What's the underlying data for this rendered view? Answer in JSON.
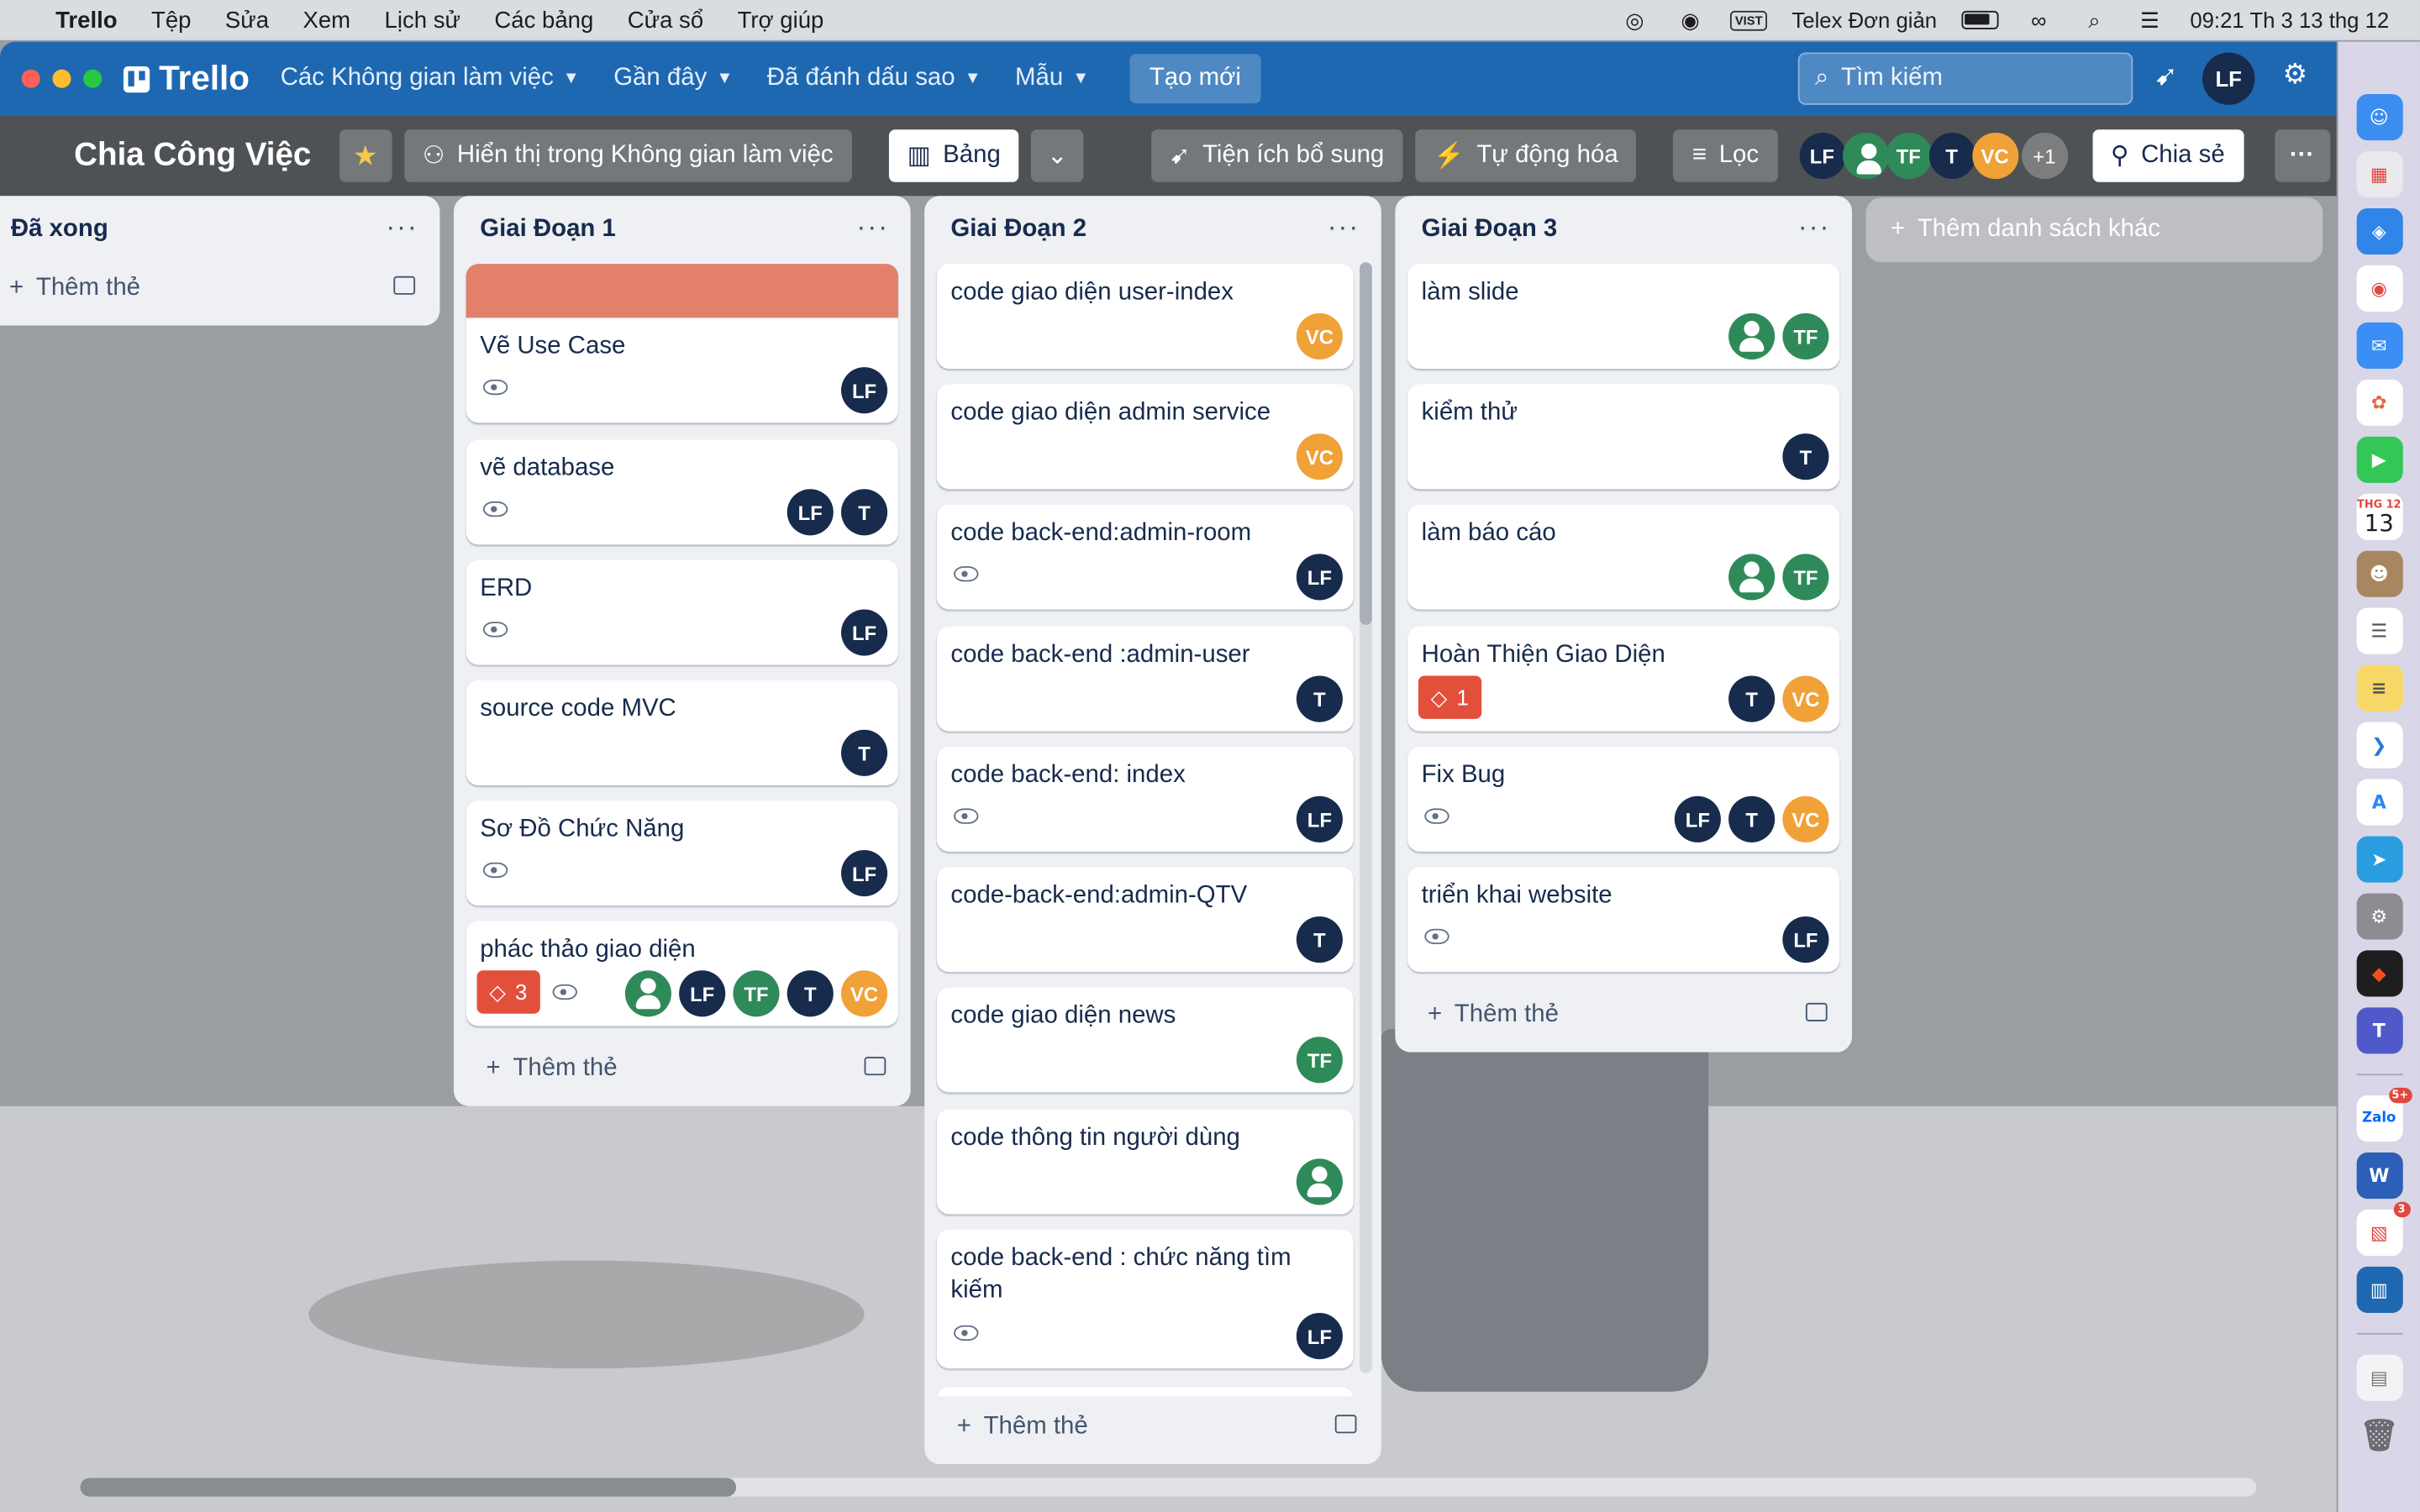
{
  "menubar": {
    "app": "Trello",
    "items": [
      "Tệp",
      "Sửa",
      "Xem",
      "Lịch sử",
      "Các bảng",
      "Cửa sổ",
      "Trợ giúp"
    ],
    "input_badge": "VIST",
    "input_method": "Telex Đơn giản",
    "clock": "09:21 Th 3 13 thg 12"
  },
  "topbar": {
    "logo": "Trello",
    "nav": [
      "Các Không gian làm việc",
      "Gần đây",
      "Đã đánh dấu sao",
      "Mẫu"
    ],
    "create": "Tạo mới",
    "search_placeholder": "Tìm kiếm",
    "user_initials": "LF"
  },
  "board": {
    "title": "Chia Công Việc",
    "visibility": "Hiển thị trong Không gian làm việc",
    "view": "Bảng",
    "powerups": "Tiện ích bổ sung",
    "automation": "Tự động hóa",
    "filter": "Lọc",
    "share": "Chia sẻ",
    "extra_members": "+1"
  },
  "add_list": "Thêm danh sách khác",
  "add_card": "Thêm thẻ",
  "lists": [
    {
      "title": "Đã xong",
      "cards": []
    },
    {
      "title": "Giai Đoạn 1",
      "cards": [
        {
          "title": "Vẽ Use Case"
        },
        {
          "title": "vẽ database"
        },
        {
          "title": "ERD"
        },
        {
          "title": "source code MVC"
        },
        {
          "title": "Sơ Đồ Chức Năng"
        },
        {
          "title": "phác thảo giao diện",
          "badge": "3"
        }
      ]
    },
    {
      "title": "Giai Đoạn 2",
      "cards": [
        {
          "title": "code giao diện user-index"
        },
        {
          "title": "code giao diện admin service"
        },
        {
          "title": "code back-end:admin-room"
        },
        {
          "title": "code back-end :admin-user"
        },
        {
          "title": "code back-end: index"
        },
        {
          "title": "code-back-end:admin-QTV"
        },
        {
          "title": "code giao diện news"
        },
        {
          "title": "code thông tin người dùng"
        },
        {
          "title": "code back-end : chức năng tìm kiếm"
        }
      ]
    },
    {
      "title": "Giai Đoạn 3",
      "cards": [
        {
          "title": "làm slide"
        },
        {
          "title": "kiểm thử"
        },
        {
          "title": "làm báo cáo"
        },
        {
          "title": "Hoàn Thiện Giao Diện",
          "badge": "1"
        },
        {
          "title": "Fix Bug"
        },
        {
          "title": "triển khai website"
        }
      ]
    }
  ],
  "members": {
    "lf": "LF",
    "t": "T",
    "tf": "TF",
    "vc": "VC"
  },
  "dock": {
    "calendar_month": "THG 12",
    "calendar_day": "13",
    "zalo": "Zalo",
    "zalo_badge": "5+",
    "word": "W",
    "badge_3": "3"
  }
}
